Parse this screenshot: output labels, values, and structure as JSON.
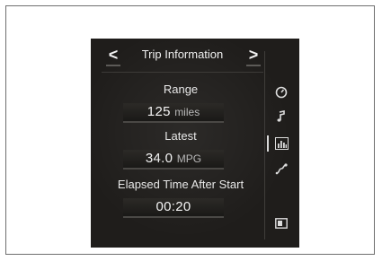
{
  "header": {
    "title": "Trip Information",
    "prev_glyph": "<",
    "next_glyph": ">"
  },
  "metrics": [
    {
      "label": "Range",
      "value": "125",
      "unit": "miles"
    },
    {
      "label": "Latest",
      "value": "34.0",
      "unit": "MPG"
    },
    {
      "label": "Elapsed Time After Start",
      "value": "00:20",
      "unit": ""
    }
  ],
  "sidebar": {
    "icons": [
      {
        "name": "gauge-icon",
        "active": false
      },
      {
        "name": "music-note-icon",
        "active": false
      },
      {
        "name": "bar-chart-icon",
        "active": true
      },
      {
        "name": "route-icon",
        "active": false
      },
      {
        "name": "screen-toggle-icon",
        "active": false
      }
    ]
  }
}
